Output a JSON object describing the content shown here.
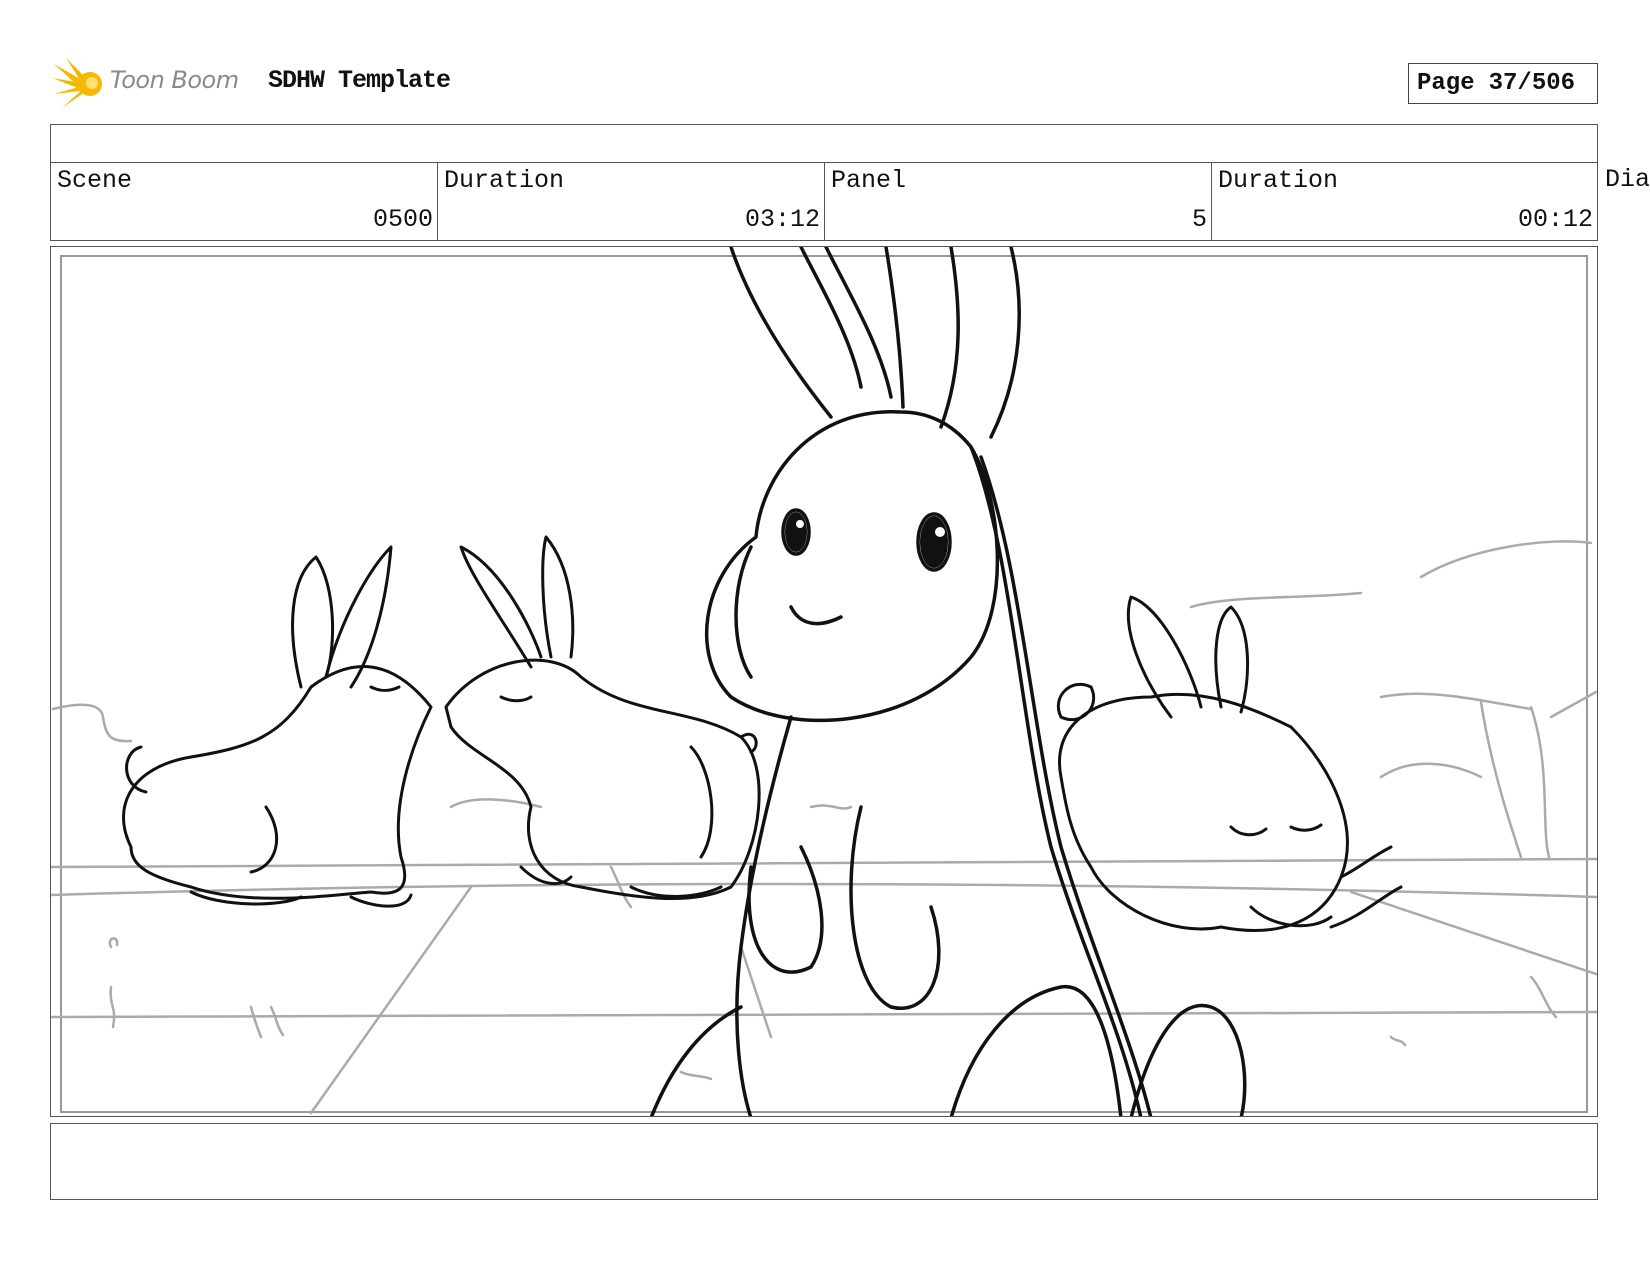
{
  "header": {
    "logo_text": "Toon Boom",
    "document_title": "SDHW Template",
    "page_label": "Page",
    "page_number": "37/506"
  },
  "info": {
    "scene": {
      "label": "Scene",
      "value": "0500"
    },
    "scene_duration": {
      "label": "Duration",
      "value": "03:12"
    },
    "panel": {
      "label": "Panel",
      "value": "5"
    },
    "panel_duration": {
      "label": "Duration",
      "value": "00:12"
    },
    "dialog_label_truncated": "Dia"
  },
  "panel_image": {
    "description_icon": "storyboard-sketch-icon"
  },
  "colors": {
    "border": "#555555",
    "logo_accent": "#f5b800",
    "sketch_dark": "#111111",
    "sketch_light": "#aaaaaa"
  }
}
